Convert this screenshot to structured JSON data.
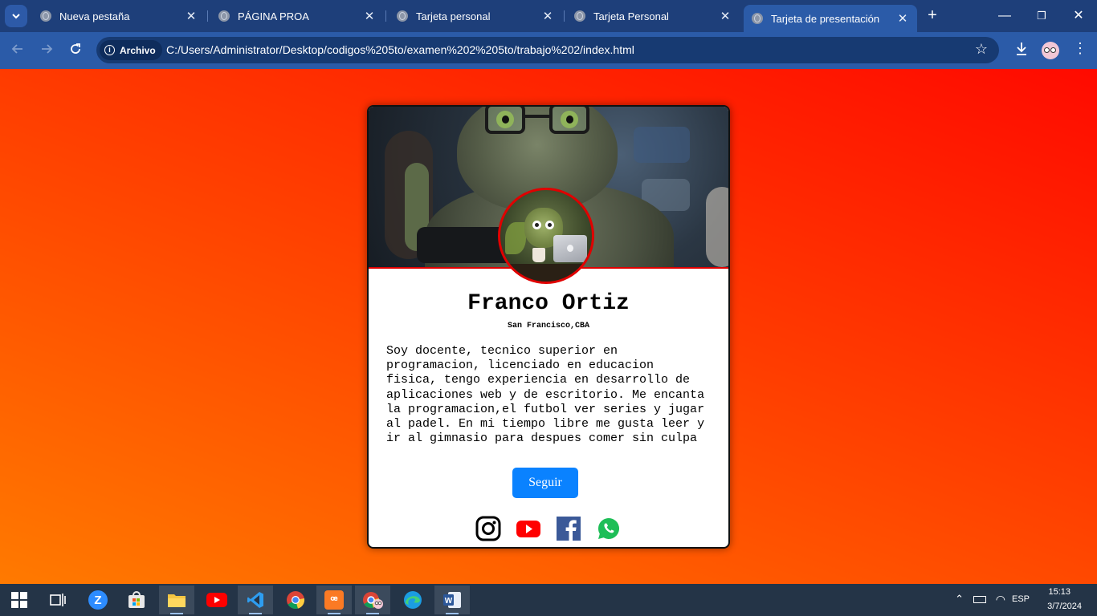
{
  "browser": {
    "tabs": [
      {
        "title": "Nueva pestaña",
        "active": false
      },
      {
        "title": "PÁGINA PROA",
        "active": false
      },
      {
        "title": "Tarjeta personal",
        "active": false
      },
      {
        "title": "Tarjeta Personal",
        "active": false
      },
      {
        "title": "Tarjeta de presentación",
        "active": true
      }
    ],
    "close_glyph": "✕",
    "new_tab_glyph": "+",
    "site_chip_label": "Archivo",
    "url": "C:/Users/Administrator/Desktop/codigos%205to/examen%202%205to/trabajo%202/index.html",
    "window_controls": {
      "minimize": "—",
      "restore": "❐",
      "close": "✕"
    }
  },
  "card": {
    "name": "Franco Ortiz",
    "location": "San Francisco,CBA",
    "bio": "Soy docente, tecnico superior en\nprogramacion, licenciado en educacion\nfisica, tengo experiencia en desarrollo de\naplicaciones web y de escritorio. Me encanta\nla programacion,el futbol ver series y jugar\nal padel. En mi tiempo libre me gusta leer y\nir al gimnasio para despues comer sin culpa",
    "follow_button": "Seguir",
    "social_icons": [
      "instagram-icon",
      "youtube-icon",
      "facebook-icon",
      "whatsapp-icon"
    ]
  },
  "colors": {
    "accent_red": "#e00000",
    "button_blue": "#0a82ff",
    "chrome_blue": "#2b5ba8"
  },
  "taskbar": {
    "apps": [
      "windows-start-icon",
      "task-view-icon",
      "zoom-icon",
      "microsoft-store-icon",
      "file-explorer-icon",
      "youtube-icon",
      "vscode-icon",
      "chrome-icon",
      "xampp-icon",
      "chrome-profile-icon",
      "edge-icon",
      "word-icon"
    ],
    "language": "ESP",
    "time": "15:13",
    "date": "3/7/2024"
  }
}
